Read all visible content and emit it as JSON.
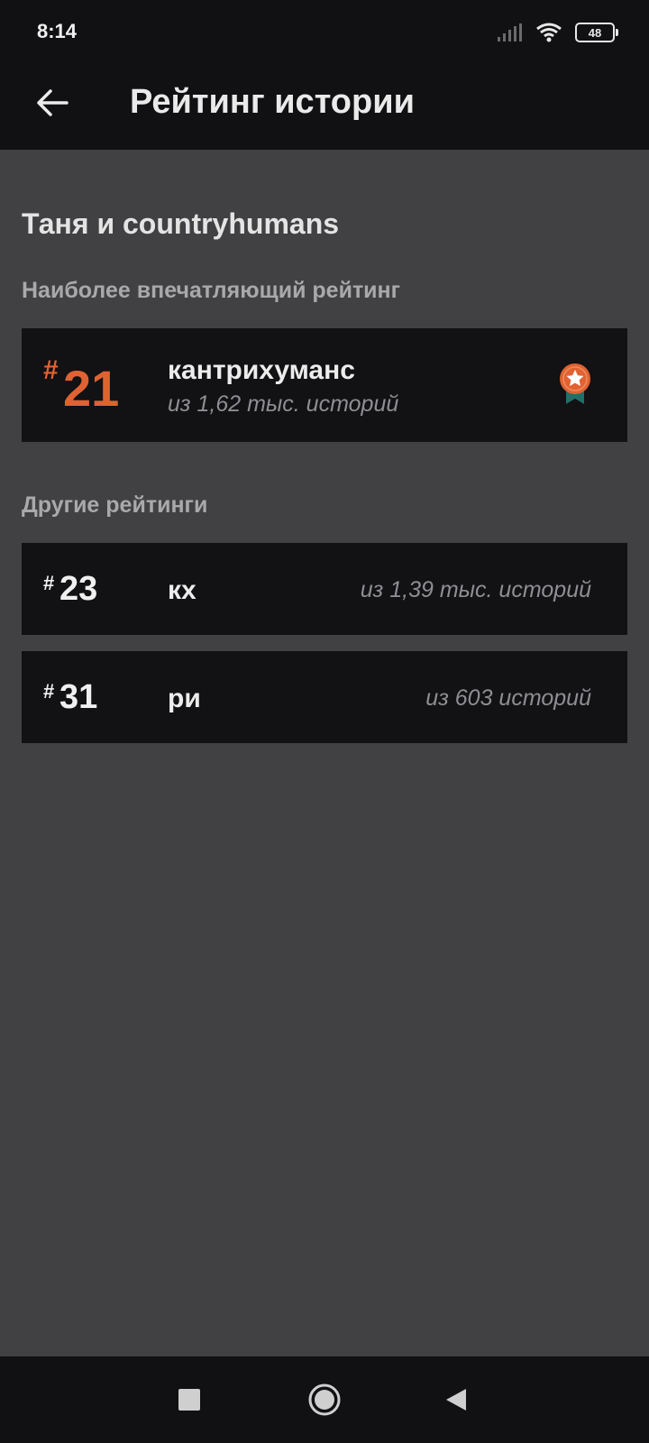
{
  "status_bar": {
    "time": "8:14",
    "battery": "48"
  },
  "app_bar": {
    "title": "Рейтинг истории"
  },
  "story": {
    "title": "Таня и countryhumans"
  },
  "sections": {
    "best_title": "Наиболее впечатляющий рейтинг",
    "other_title": "Другие рейтинги"
  },
  "best_rating": {
    "hash": "#",
    "rank": "21",
    "tag": "кантрихуманс",
    "count": "из 1,62 тыс. историй"
  },
  "other_ratings": [
    {
      "hash": "#",
      "rank": "23",
      "tag": "кх",
      "count": "из 1,39 тыс. историй"
    },
    {
      "hash": "#",
      "rank": "31",
      "tag": "ри",
      "count": "из 603 историй"
    }
  ],
  "colors": {
    "accent": "#e06232",
    "medal_ribbon": "#1f6f6a",
    "background": "#414043",
    "card": "#121114"
  },
  "icons": {
    "back": "arrow-left-icon",
    "medal": "medal-star-icon",
    "signal": "cellular-signal-icon",
    "wifi": "wifi-icon",
    "nav_recent": "square-icon",
    "nav_home": "circle-icon",
    "nav_back": "triangle-back-icon"
  }
}
